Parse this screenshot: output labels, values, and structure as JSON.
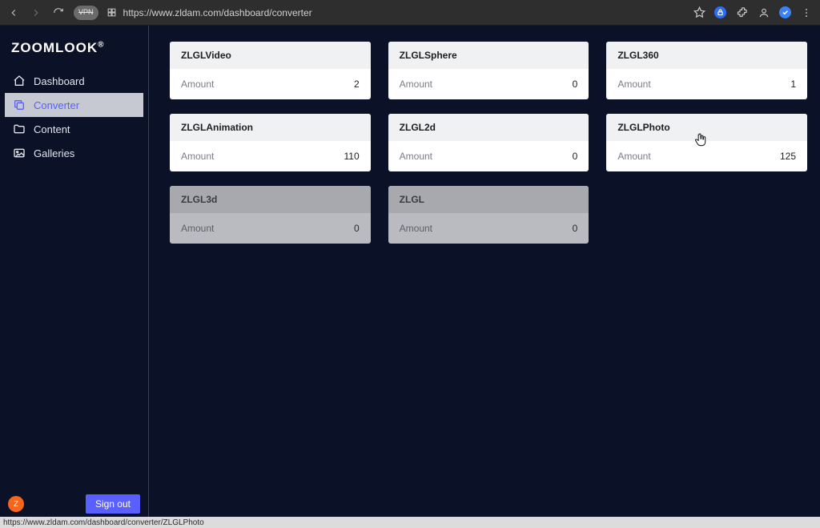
{
  "browser": {
    "url": "https://www.zldam.com/dashboard/converter",
    "vpn_label": "VPN"
  },
  "brand": "ZOOMLOOK",
  "sidebar": {
    "items": [
      {
        "label": "Dashboard"
      },
      {
        "label": "Converter"
      },
      {
        "label": "Content"
      },
      {
        "label": "Galleries"
      }
    ],
    "avatar_letter": "Z",
    "sign_out": "Sign out"
  },
  "amount_label": "Amount",
  "cards": [
    {
      "title": "ZLGLVideo",
      "amount": "2",
      "disabled": false
    },
    {
      "title": "ZLGLSphere",
      "amount": "0",
      "disabled": false
    },
    {
      "title": "ZLGL360",
      "amount": "1",
      "disabled": false
    },
    {
      "title": "ZLGLAnimation",
      "amount": "110",
      "disabled": false
    },
    {
      "title": "ZLGL2d",
      "amount": "0",
      "disabled": false
    },
    {
      "title": "ZLGLPhoto",
      "amount": "125",
      "disabled": false
    },
    {
      "title": "ZLGL3d",
      "amount": "0",
      "disabled": true
    },
    {
      "title": "ZLGL",
      "amount": "0",
      "disabled": true
    }
  ],
  "status_text": "https://www.zldam.com/dashboard/converter/ZLGLPhoto"
}
